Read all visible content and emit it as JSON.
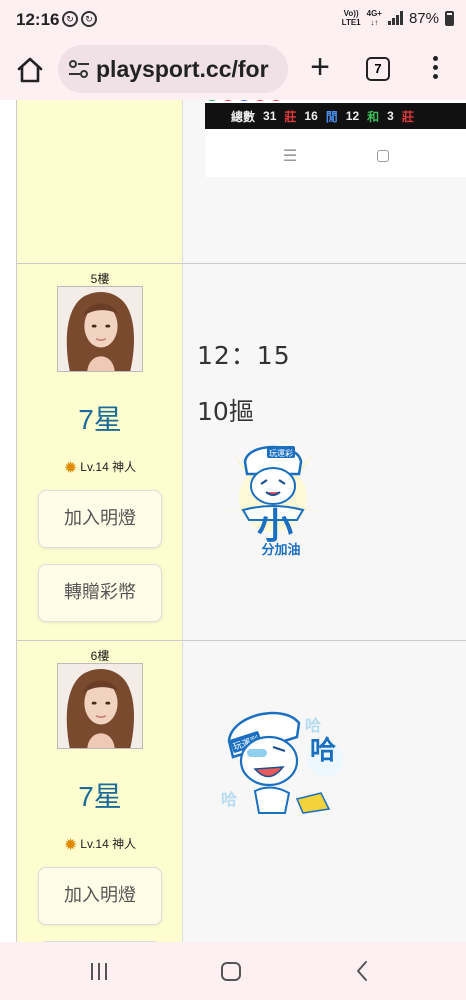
{
  "status": {
    "time": "12:16",
    "network_top": "Vo))",
    "network_bottom": "LTE1",
    "network2_top": "4G+",
    "network2_bottom": "↓↑",
    "battery": "87%"
  },
  "browser": {
    "url": "playsport.cc/for",
    "tab_count": "7"
  },
  "embed_stats": {
    "total_label": "總數",
    "total_value": "31",
    "banker_label": "莊",
    "banker_value": "16",
    "player_label": "閒",
    "player_value": "12",
    "tie_label": "和",
    "tie_value": "3",
    "extra_label": "莊"
  },
  "posts": [
    {
      "floor": "5樓",
      "stars": "7星",
      "level": "Lv.14 神人",
      "button_light": "加入明燈",
      "button_gift": "轉贈彩幣",
      "line1": "12：15",
      "line2": "10摳",
      "sticker_text": "分加油",
      "sticker_big": "小",
      "sticker_cap": "玩運彩"
    },
    {
      "floor": "6樓",
      "stars": "7星",
      "level": "Lv.14 神人",
      "button_light": "加入明燈",
      "sticker_big": "哈",
      "sticker_small": "哈",
      "sticker_cap": "玩運彩"
    }
  ],
  "colors": {
    "user_col": "#fdfdd0",
    "star_text": "#1b6a98",
    "chrome": "#fdf0f3"
  }
}
